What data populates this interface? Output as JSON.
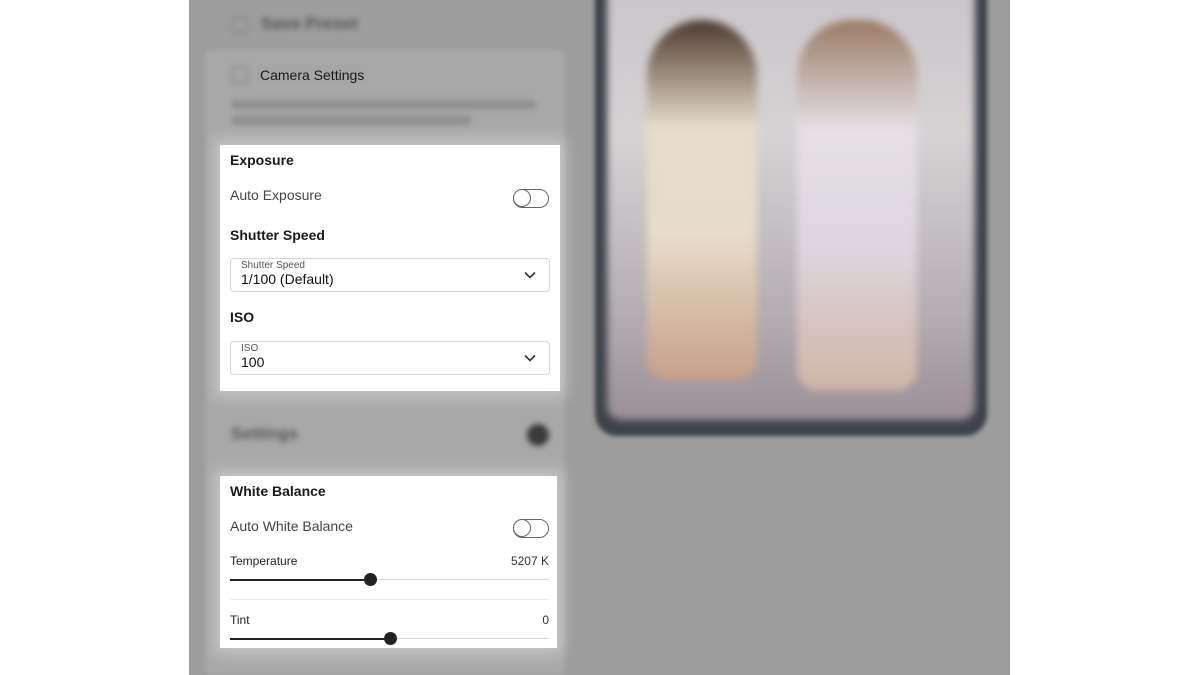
{
  "header": {
    "collapsed_item_label": "Save Preset"
  },
  "camera_settings": {
    "title": "Camera Settings",
    "description": "Adjust the camera exposure and white balance settings to match your scene lighting"
  },
  "exposure": {
    "title": "Exposure",
    "auto_label": "Auto Exposure",
    "auto_enabled": false,
    "shutter": {
      "heading": "Shutter Speed",
      "field_label": "Shutter Speed",
      "value": "1/100 (Default)"
    },
    "iso": {
      "heading": "ISO",
      "field_label": "ISO",
      "value": "100"
    }
  },
  "blurred_section": {
    "label": "Settings"
  },
  "white_balance": {
    "title": "White Balance",
    "auto_label": "Auto White Balance",
    "auto_enabled": false,
    "temperature": {
      "label": "Temperature",
      "value_text": "5207 K",
      "fraction": 0.44
    },
    "tint": {
      "label": "Tint",
      "value_text": "0",
      "fraction": 0.5
    }
  },
  "icons": {
    "chevron": "chevron-down-icon",
    "checkbox": "checkbox-icon"
  }
}
